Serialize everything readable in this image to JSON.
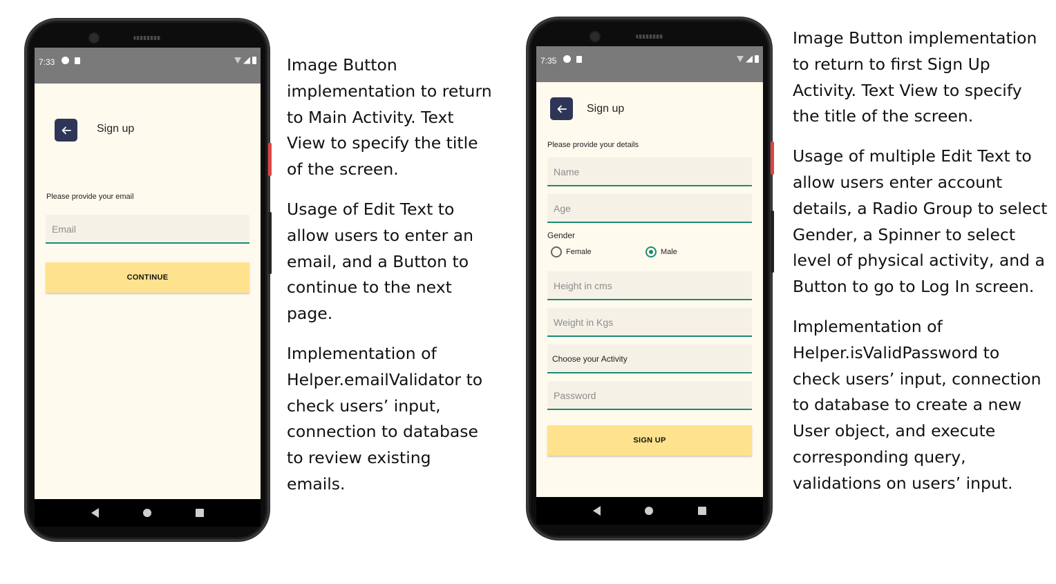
{
  "screen1": {
    "status_time": "7:33",
    "title": "Sign up",
    "hint": "Please provide your email",
    "email_placeholder": "Email",
    "button_label": "CONTINUE"
  },
  "screen2": {
    "status_time": "7:35",
    "title": "Sign up",
    "hint": "Please provide your details",
    "name_placeholder": "Name",
    "age_placeholder": "Age",
    "gender_label": "Gender",
    "gender_options": [
      "Female",
      "Male"
    ],
    "gender_selected": "Male",
    "height_placeholder": "Height in cms",
    "weight_placeholder": "Weight in Kgs",
    "activity_value": "Choose your Activity",
    "password_placeholder": "Password",
    "button_label": "SIGN UP"
  },
  "descriptions": {
    "left": [
      "Image Button implementation to return to Main Activity. Text View to specify the title of the screen.",
      "Usage of Edit Text to allow users to enter an email, and a Button to continue to the next page.",
      "Implementation of Helper.emailValidator to check users’ input, connection to database to review existing emails."
    ],
    "right": [
      "Image Button implementation to return to first Sign Up Activity. Text View to specify the title of the screen.",
      "Usage of multiple Edit Text to allow users enter account details, a Radio Group to select Gender, a Spinner to select level of physical activity, and a Button to go to Log In screen.",
      "Implementation of Helper.isValidPassword to check users’ input, connection to database to create a new User object, and execute corresponding query, validations on users’ input."
    ]
  },
  "colors": {
    "background": "#fffaee",
    "accent_teal": "#1a8a74",
    "button_yellow": "#ffe28e",
    "back_button": "#2f3557",
    "status_bar": "#7a7a7a"
  }
}
